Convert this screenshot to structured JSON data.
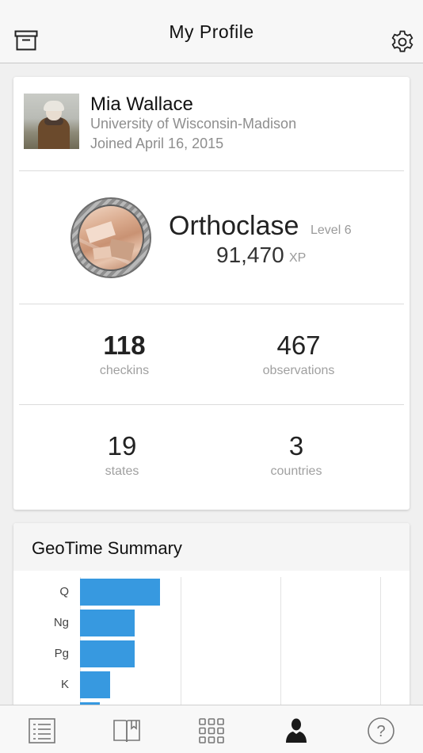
{
  "header": {
    "title": "My Profile",
    "left_icon": "archive-box-icon",
    "right_icon": "gear-icon"
  },
  "profile": {
    "name": "Mia Wallace",
    "school": "University of Wisconsin-Madison",
    "joined": "Joined April 16, 2015",
    "avatar_icon": "avatar-photo"
  },
  "rank": {
    "mineral": "Orthoclase",
    "level": "Level 6",
    "xp": "91,470",
    "xp_unit": "XP",
    "badge_icon": "mineral-badge"
  },
  "stats": {
    "checkins": {
      "value": "118",
      "label": "checkins"
    },
    "observations": {
      "value": "467",
      "label": "observations"
    },
    "states": {
      "value": "19",
      "label": "states"
    },
    "countries": {
      "value": "3",
      "label": "countries"
    }
  },
  "geotime": {
    "title": "GeoTime Summary",
    "bars": [
      {
        "label": "Q",
        "value": 0.8
      },
      {
        "label": "Ng",
        "value": 0.55
      },
      {
        "label": "Pg",
        "value": 0.55
      },
      {
        "label": "K",
        "value": 0.3
      },
      {
        "label": "",
        "value": 0.2
      }
    ],
    "bar_color": "#3799e0"
  },
  "tabbar": {
    "tabs": [
      {
        "icon": "list-icon"
      },
      {
        "icon": "book-icon"
      },
      {
        "icon": "grid-icon"
      },
      {
        "icon": "profile-icon",
        "active": true
      },
      {
        "icon": "help-icon"
      }
    ]
  }
}
